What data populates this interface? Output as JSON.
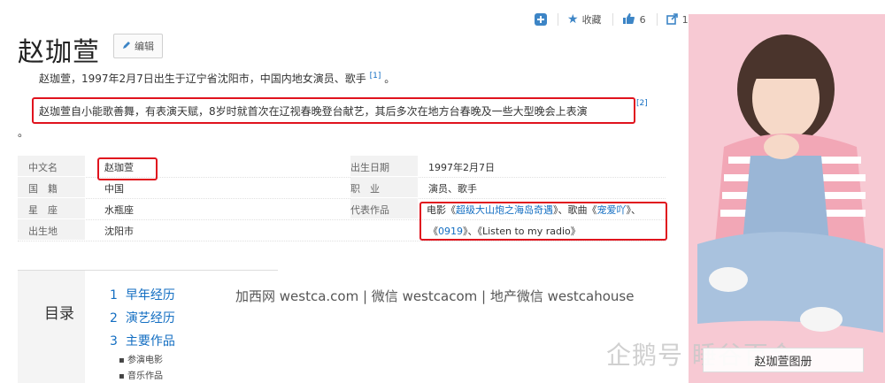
{
  "toolbar": {
    "favorite_label": "收藏",
    "like_count": "6",
    "share_count": "1"
  },
  "title": "赵珈萱",
  "edit_label": "编辑",
  "summary": {
    "line1": "赵珈萱，1997年2月7日出生于辽宁省沈阳市，中国内地女演员、歌手",
    "ref1": "[1]",
    "line1_end": "。",
    "line2": "赵珈萱自小能歌善舞，有表演天赋，8岁时就首次在辽视春晚登台献艺，其后多次在地方台春晚及一些大型晚会上表演",
    "ref2": "[2]",
    "line2_end": "。"
  },
  "info": {
    "rows": [
      {
        "l_label": "中文名",
        "l_value": "赵珈萱",
        "r_label": "出生日期",
        "r_value": "1997年2月7日"
      },
      {
        "l_label": "国　籍",
        "l_value": "中国",
        "r_label": "职　业",
        "r_value": "演员、歌手"
      },
      {
        "l_label": "星　座",
        "l_value": "水瓶座",
        "r_label": "代表作品"
      },
      {
        "l_label": "出生地",
        "l_value": "沈阳市"
      }
    ],
    "works": {
      "p1": "电影《",
      "film": "超级大山炮之海岛奇遇",
      "p2": "》、歌曲《",
      "song1": "宠爱吖",
      "p3": "》、",
      "p4": "《",
      "song2": "0919",
      "p5": "》、《Listen to my radio》"
    }
  },
  "toc": {
    "title": "目录",
    "items": [
      {
        "num": "1",
        "label": "早年经历"
      },
      {
        "num": "2",
        "label": "演艺经历"
      },
      {
        "num": "3",
        "label": "主要作品"
      }
    ],
    "subitems": [
      "参演电影",
      "音乐作品"
    ]
  },
  "watermark": "加西网 westca.com | 微信 westcacom | 地产微信 westcahouse",
  "photo": {
    "caption": "赵珈萱图册",
    "overlay": "企鹅号 睡谷百合"
  },
  "colors": {
    "link": "#136ec2",
    "highlight": "#e0131e",
    "photo_bg": "#f7c9d3"
  }
}
